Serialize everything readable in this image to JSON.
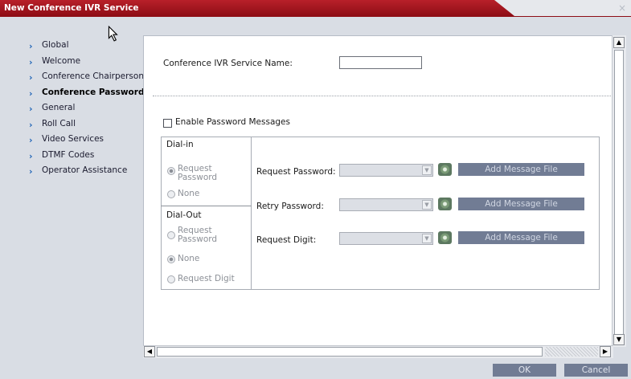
{
  "window": {
    "title": "New Conference IVR Service",
    "close_glyph": "×"
  },
  "nav": {
    "items": [
      {
        "label": "Global"
      },
      {
        "label": "Welcome"
      },
      {
        "label": "Conference Chairperson"
      },
      {
        "label": "Conference Password",
        "active": true
      },
      {
        "label": "General"
      },
      {
        "label": "Roll Call"
      },
      {
        "label": "Video Services"
      },
      {
        "label": "DTMF Codes"
      },
      {
        "label": "Operator Assistance"
      }
    ]
  },
  "form": {
    "service_name_label": "Conference IVR Service Name:",
    "service_name_value": "",
    "enable_password_label": "Enable Password Messages",
    "enable_password_checked": false
  },
  "dial_in": {
    "header": "Dial-in",
    "options": [
      {
        "label": "Request\nPassword",
        "selected": true
      },
      {
        "label": "None",
        "selected": false
      }
    ]
  },
  "dial_out": {
    "header": "Dial-Out",
    "options": [
      {
        "label": "Request\nPassword",
        "selected": false
      },
      {
        "label": "None",
        "selected": true
      },
      {
        "label": "Request Digit",
        "selected": false
      }
    ]
  },
  "messages": [
    {
      "label": "Request Password:",
      "value": "",
      "button": "Add Message File"
    },
    {
      "label": "Retry Password:",
      "value": "",
      "button": "Add Message File"
    },
    {
      "label": "Request Digit:",
      "value": "",
      "button": "Add Message File"
    }
  ],
  "footer": {
    "ok_label": "OK",
    "cancel_label": "Cancel"
  },
  "icons": {
    "nav_bullet": "chevron-right-icon",
    "play": "speaker-icon",
    "scroll_up": "scroll-up-icon",
    "scroll_down": "scroll-down-icon",
    "scroll_left": "scroll-left-icon",
    "scroll_right": "scroll-right-icon"
  },
  "colors": {
    "title_bar": "#a9141c",
    "nav_chevron": "#1f64b6",
    "button": "#717c94"
  }
}
